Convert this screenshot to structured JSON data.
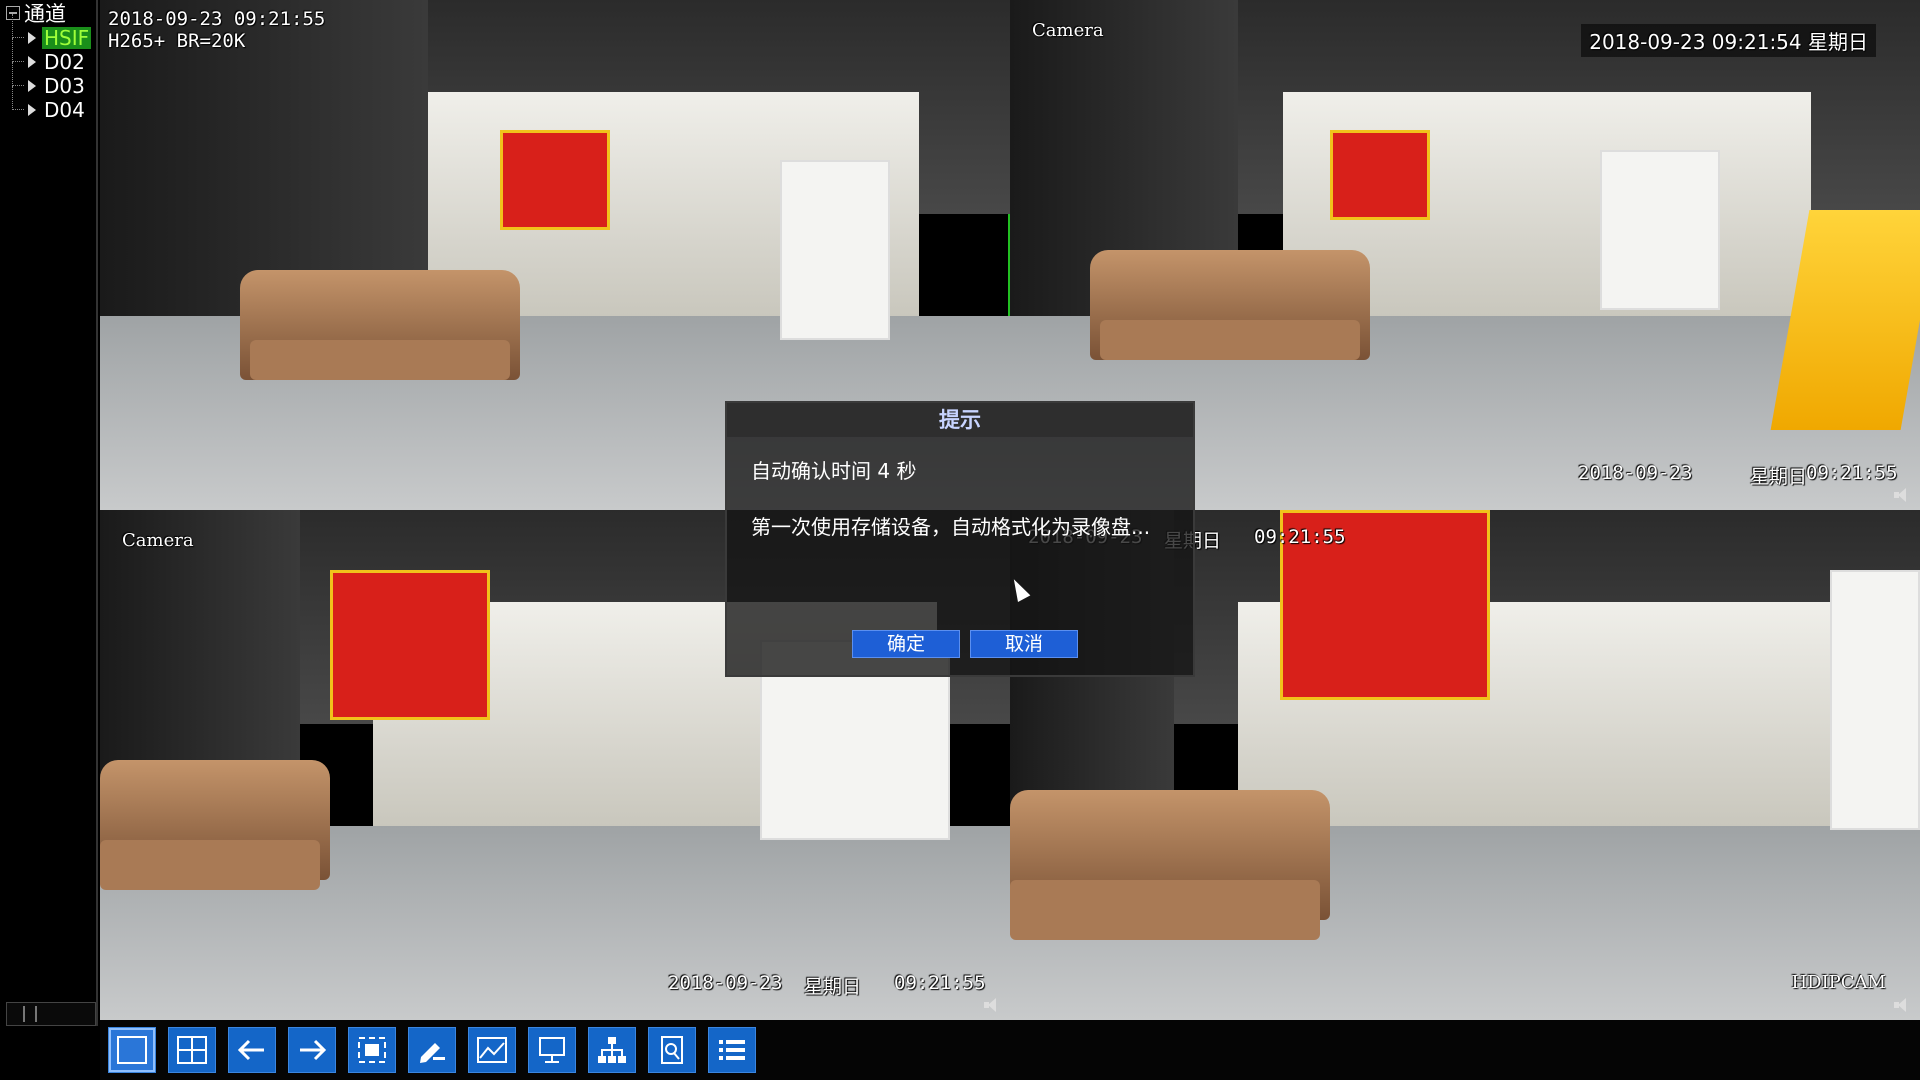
{
  "sidebar": {
    "root_label": "通道",
    "channels": [
      "HSIF",
      "D02",
      "D03",
      "D04"
    ]
  },
  "tiles": [
    {
      "top_left_lines": [
        "2018-09-23 09:21:55",
        "H265+ BR=20K"
      ]
    },
    {
      "camera_name": "Camera",
      "datetime": "2018-09-23 09:21:54 星期日",
      "bottom_date": "2018-09-23",
      "bottom_weekday": "星期日",
      "bottom_time": "09:21:55"
    },
    {
      "camera_name": "Camera",
      "top_date": "2018-09-23",
      "top_weekday": "星期日",
      "top_time": "09:21:55",
      "bottom_date": "2018-09-23",
      "bottom_weekday": "星期日",
      "bottom_time": "09:21:55"
    },
    {
      "camera_name": "HDIPCAM"
    }
  ],
  "dialog": {
    "title": "提示",
    "countdown": "自动确认时间 4 秒",
    "message": "第一次使用存储设备，自动格式化为录像盘...",
    "ok_label": "确定",
    "cancel_label": "取消"
  },
  "toolbar": {
    "buttons": [
      "single-view",
      "quad-view",
      "previous",
      "next",
      "fullscreen",
      "ptz-control",
      "image-settings",
      "monitor",
      "network",
      "search",
      "menu"
    ]
  },
  "colors": {
    "selection_green": "#22c022",
    "button_blue": "#1466c8",
    "title_text": "#c8d4ff"
  }
}
